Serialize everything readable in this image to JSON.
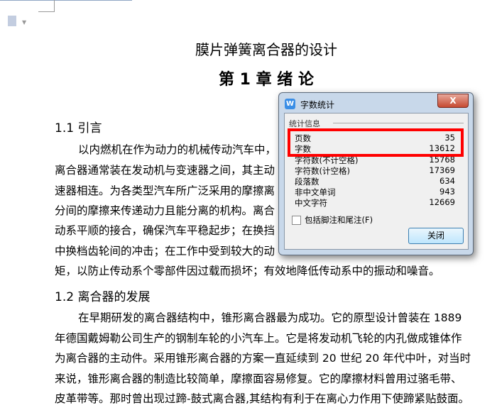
{
  "document": {
    "title": "膜片弹簧离合器的设计",
    "chapter": "第 1 章  绪   论",
    "section1": {
      "heading": "1.1 引言",
      "lines": [
        "以内燃机在作为动力的机械传动汽车中，",
        "离合器通常装在发动机与变速器之间，其主动",
        "速器相连。为各类型汽车所广泛采用的摩擦离",
        "分间的摩擦来传递动力且能分离的机构。离合",
        "动系平顺的接合，确保汽车平稳起步；在换挡",
        "中换档齿轮间的冲击；在工作中受到较大的动",
        "矩，以防止传动系个零部件因过载而损坏；有效地降低传动系中的振动和噪音。"
      ]
    },
    "section2": {
      "heading": "1.2 离合器的发展",
      "lines": [
        "在早期研发的离合器结构中，锥形离合器最为成功。它的原型设计曾装在 1889",
        "年德国戴姆勒公司生产的钢制车轮的小汽车上。它是将发动机飞轮的内孔做成锥体作",
        "为离合器的主动件。采用锥形离合器的方案一直延续到 20 世纪 20 年代中叶，对当时",
        "来说，锥形离合器的制造比较简单，摩擦面容易修复。它的摩擦材料曾用过骆毛带、",
        "皮革带等。那时曾出现过蹄-鼓式离合器,其结构有利于在离心力作用下使蹄紧贴鼓面。"
      ]
    }
  },
  "dialog": {
    "title": "字数统计",
    "group_label": "统计信息",
    "stats": [
      {
        "label": "页数",
        "value": "35"
      },
      {
        "label": "字数",
        "value": "13612"
      },
      {
        "label": "字符数(不计空格)",
        "value": "15768"
      },
      {
        "label": "字符数(计空格)",
        "value": "17369"
      },
      {
        "label": "段落数",
        "value": "634"
      },
      {
        "label": "非中文单词",
        "value": "943"
      },
      {
        "label": "中文字符",
        "value": "12669"
      }
    ],
    "checkbox_label": "包括脚注和尾注(F)",
    "checkbox_checked": false,
    "close_button": "关闭",
    "close_x": "X",
    "app_icon": "W"
  }
}
